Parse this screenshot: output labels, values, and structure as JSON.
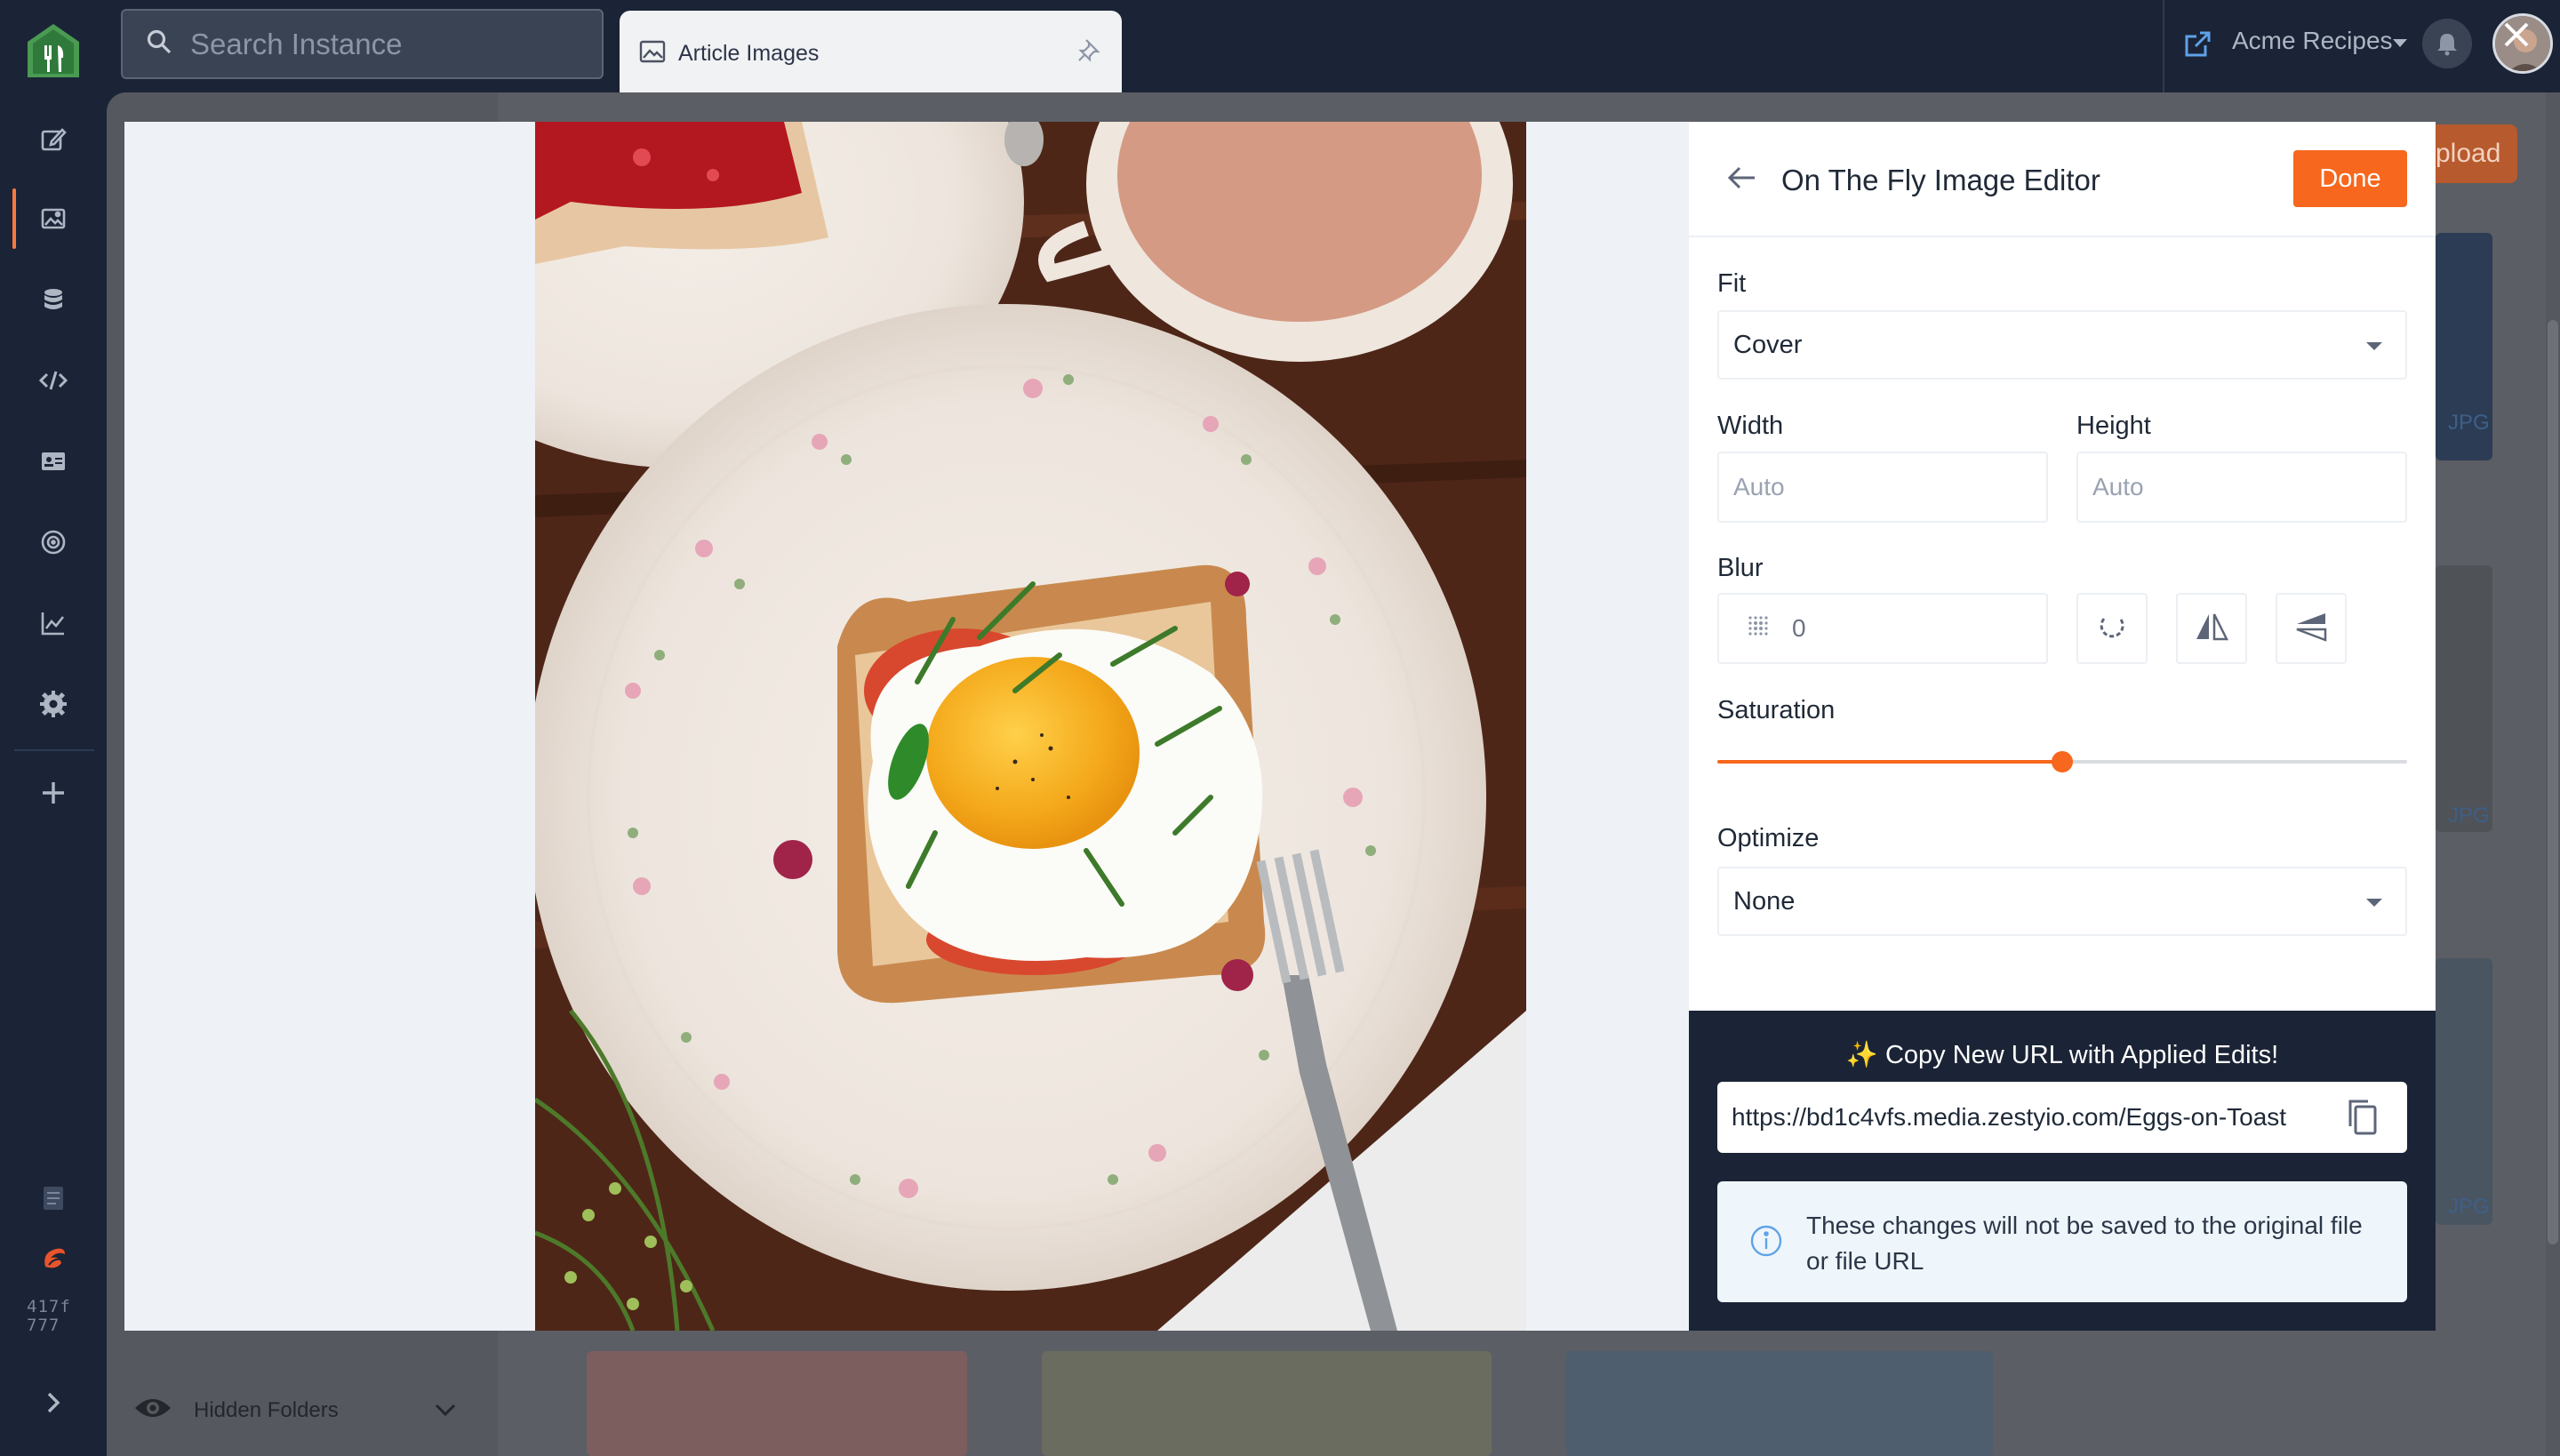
{
  "app": {
    "search_placeholder": "Search Instance",
    "tab_label": "Article Images",
    "instance_name": "Acme Recipes",
    "build_hash_line1": "417f",
    "build_hash_line2": "777",
    "accent_color": "#f7671d"
  },
  "rail": {
    "icons": [
      "content-icon",
      "media-icon",
      "schema-icon",
      "code-icon",
      "leads-icon",
      "seo-icon",
      "analytics-icon",
      "settings-icon",
      "add-icon",
      "docs-icon",
      "zesty-icon",
      "expand-icon"
    ]
  },
  "background": {
    "hidden_folders_label": "Hidden Folders",
    "upload_label": "pload",
    "file_type_tag": "JPG"
  },
  "editor": {
    "title": "On The Fly Image Editor",
    "done_label": "Done",
    "fit_label": "Fit",
    "fit_value": "Cover",
    "width_label": "Width",
    "width_placeholder": "Auto",
    "height_label": "Height",
    "height_placeholder": "Auto",
    "blur_label": "Blur",
    "blur_value": "0",
    "saturation_label": "Saturation",
    "saturation_fraction": 0.5,
    "optimize_label": "Optimize",
    "optimize_value": "None",
    "copy_title": "✨ Copy New URL with Applied Edits!",
    "url": "https://bd1c4vfs.media.zestyio.com/Eggs-on-Toast",
    "info_text": "These changes will not be saved to the original file or file URL"
  }
}
